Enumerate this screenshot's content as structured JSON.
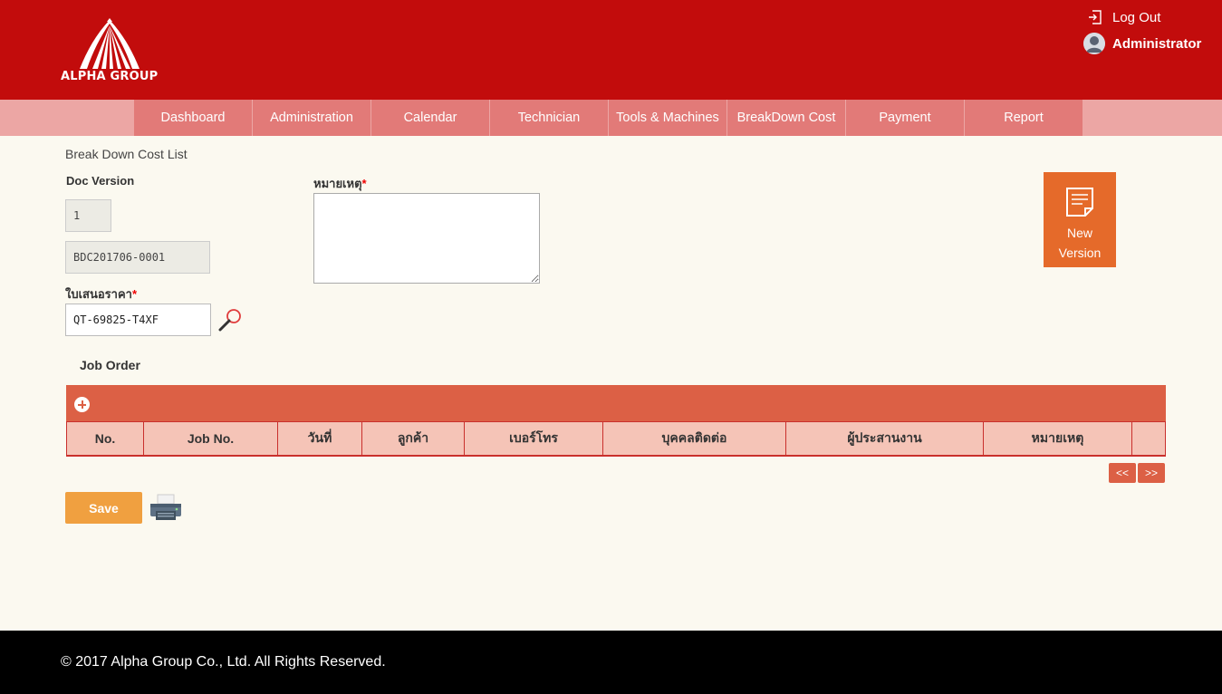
{
  "header": {
    "brand": "ALPHA GROUP",
    "logout_label": "Log Out",
    "user_name": "Administrator"
  },
  "nav": {
    "items": [
      "Dashboard",
      "Administration",
      "Calendar",
      "Technician",
      "Tools & Machines",
      "BreakDown Cost",
      "Payment",
      "Report"
    ]
  },
  "page": {
    "title": "Break Down Cost List"
  },
  "form": {
    "doc_version_label": "Doc Version",
    "doc_version_value": "1",
    "doc_number_value": "BDC201706-0001",
    "quotation_label": "ใบเสนอราคา",
    "quotation_value": "QT-69825-T4XF",
    "remark_label": "หมายเหตุ",
    "required_mark": "*",
    "remark_value": ""
  },
  "new_version": {
    "label_line1": "New",
    "label_line2": "Version"
  },
  "job_order": {
    "label": "Job Order",
    "columns": [
      "No.",
      "Job No.",
      "วันที่",
      "ลูกค้า",
      "เบอร์โทร",
      "บุคคลติดต่อ",
      "ผู้ประสานงาน",
      "หมายเหตุ",
      ""
    ],
    "prev_label": "<<",
    "next_label": ">>"
  },
  "actions": {
    "save_label": "Save"
  },
  "footer": {
    "copyright": "© 2017 Alpha Group Co., Ltd. All Rights Reserved."
  },
  "colors": {
    "header_bg": "#c20c0c",
    "nav_item_bg": "#e27a78",
    "grid_bar_bg": "#dc6045",
    "new_version_bg": "#e56a2a",
    "save_bg": "#f0a040"
  }
}
